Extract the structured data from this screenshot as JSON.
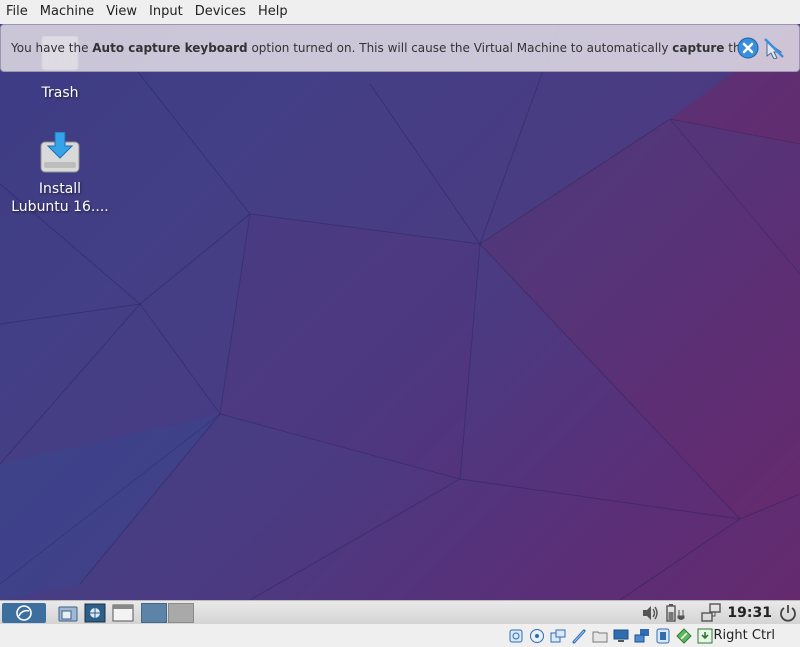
{
  "menubar": {
    "items": [
      "File",
      "Machine",
      "View",
      "Input",
      "Devices",
      "Help"
    ]
  },
  "notice": {
    "text_1": "You have the ",
    "bold_1": "Auto capture keyboard",
    "text_2": " option turned on. This will cause the Virtual Machine to automatically ",
    "bold_2": "capture",
    "text_3": " the"
  },
  "desktop": {
    "icons": [
      {
        "label": "Trash",
        "icon": "trash-icon"
      },
      {
        "label_line1": "Install",
        "label_line2": "Lubuntu 16....",
        "icon": "install-icon"
      }
    ]
  },
  "panel": {
    "clock": "19:31"
  },
  "statusbar": {
    "host_key": "Right Ctrl"
  },
  "colors": {
    "desktop_blue": "#3c3b83",
    "desktop_magenta": "#652a6e",
    "accent_blue": "#2f8ed8"
  }
}
